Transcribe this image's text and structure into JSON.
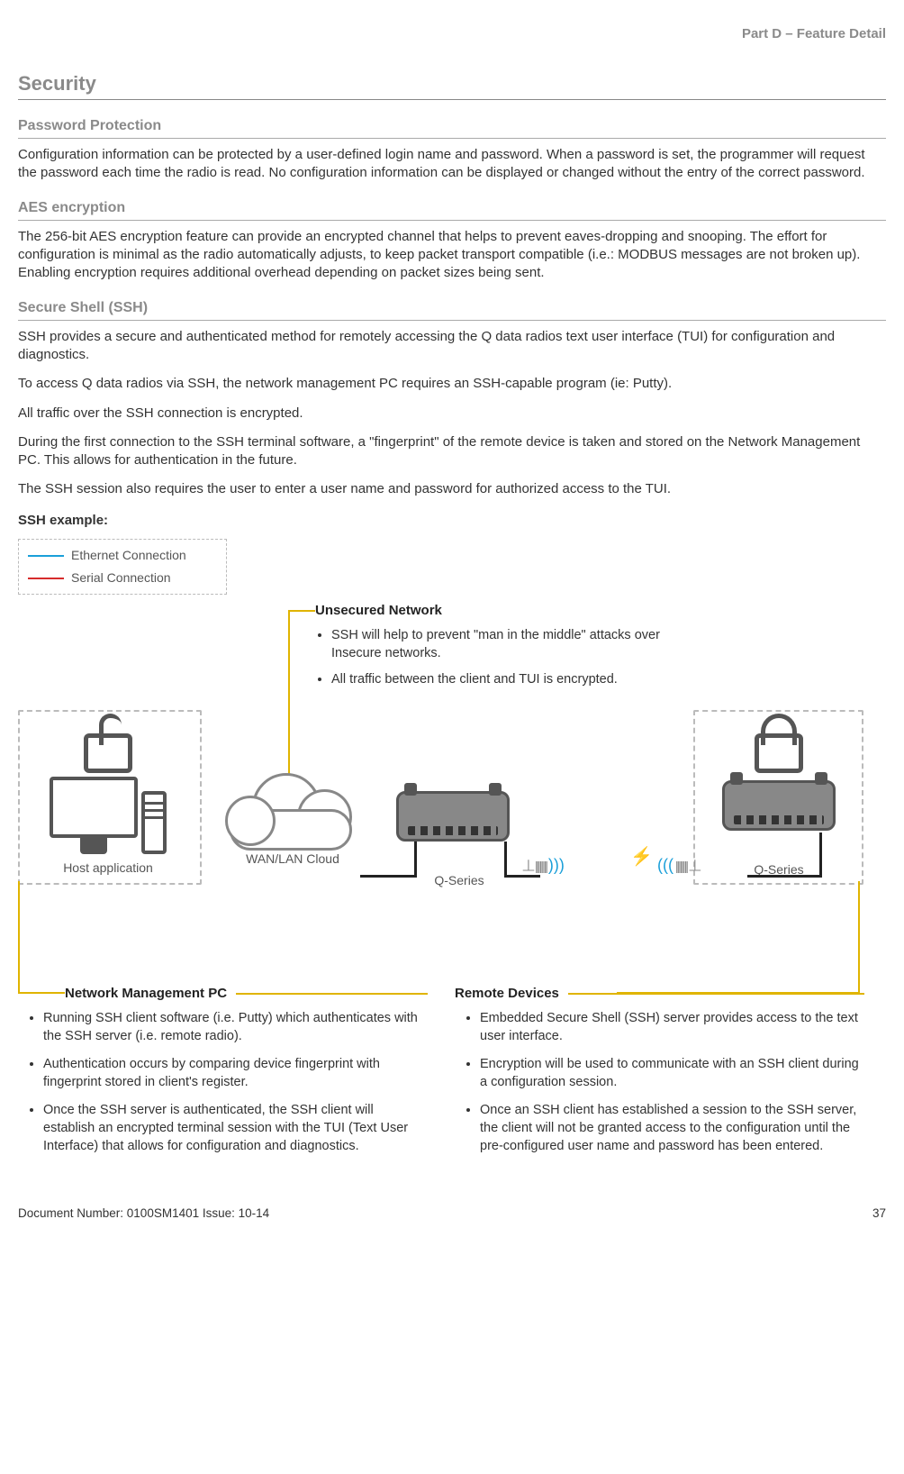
{
  "header": {
    "part": "Part D – Feature Detail"
  },
  "h1": "Security",
  "sections": {
    "pw": {
      "title": "Password Protection",
      "body": "Configuration information can be protected by a user-defined login name and password. When a password is set, the programmer will request the password each time the radio is read. No configuration information can be displayed or changed without the entry of the correct password."
    },
    "aes": {
      "title": "AES encryption",
      "body": "The 256-bit AES encryption feature can provide an encrypted channel that helps to prevent eaves-dropping and snooping. The effort for configuration is minimal as the radio automatically adjusts, to keep packet transport compatible (i.e.: MODBUS messages are not broken up). Enabling encryption requires additional overhead depending on packet sizes being sent."
    },
    "ssh": {
      "title": "Secure Shell (SSH)",
      "p1": "SSH provides a secure and authenticated method for remotely accessing the Q data radios text user interface (TUI) for configuration and diagnostics.",
      "p2": "To access Q data radios via SSH, the network management PC requires an SSH-capable program (ie: Putty).",
      "p3": "All traffic over the SSH connection is encrypted.",
      "p4": "During the first connection to the SSH terminal software, a \"fingerprint\" of the remote device is taken and stored on the Network Management PC. This allows for authentication in the future.",
      "p5": "The SSH session also requires the user to enter a user name and password for authorized access to the TUI.",
      "example_label": "SSH example:"
    }
  },
  "diagram": {
    "legend": {
      "eth": "Ethernet Connection",
      "ser": "Serial Connection"
    },
    "labels": {
      "host": "Host application",
      "cloud": "WAN/LAN Cloud",
      "q1": "Q-Series",
      "q2": "Q-Series"
    },
    "unsecured": {
      "title": "Unsecured Network",
      "b1": "SSH will help to prevent \"man in the middle\" attacks over Insecure networks.",
      "b2": "All traffic between the client and TUI is encrypted."
    },
    "nmpc": {
      "title": "Network Management PC",
      "b1": "Running SSH client software (i.e. Putty) which authenticates with the SSH server (i.e. remote radio).",
      "b2": "Authentication occurs by comparing device fingerprint with fingerprint stored in client's register.",
      "b3": "Once the SSH server is authenticated, the SSH client will establish an encrypted terminal session with the TUI (Text User Interface) that allows for configuration and diagnostics."
    },
    "remote": {
      "title": "Remote Devices",
      "b1": "Embedded  Secure Shell (SSH) server provides access to the text user interface.",
      "b2": "Encryption will be used to communicate with an SSH client during a configuration session.",
      "b3": "Once an SSH client has established a session to the SSH server, the client will not be granted access to the configuration until the pre-configured user name and password has been entered."
    }
  },
  "footer": {
    "doc": "Document Number: 0100SM1401   Issue: 10-14",
    "page": "37"
  }
}
